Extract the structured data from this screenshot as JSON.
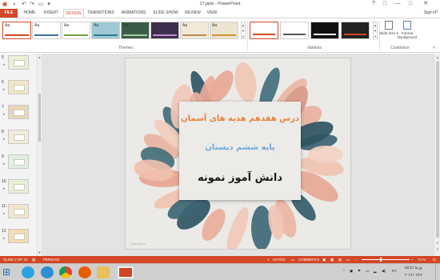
{
  "window": {
    "title": "17.pptx - PowerPoint",
    "controls": [
      "?",
      "□",
      "—",
      "□",
      "✕"
    ]
  },
  "quick_access": [
    "floppy-disk-icon",
    "undo-icon",
    "redo-icon",
    "slideshow-icon"
  ],
  "ribbon": {
    "tabs": [
      "FILE",
      "HOME",
      "INSERT",
      "DESIGN",
      "TRANSITIONS",
      "ANIMATIONS",
      "SLIDE SHOW",
      "REVIEW",
      "VIEW"
    ],
    "active_tab": "DESIGN",
    "sign_in": "Sign in",
    "themes": {
      "label": "Themes",
      "items": [
        {
          "name": "Aa",
          "bg": "#ffffff",
          "accent": "#d24726"
        },
        {
          "name": "Aa",
          "bg": "#ffffff",
          "accent": "#3a6ea5"
        },
        {
          "name": "Aa",
          "bg": "#ffffff",
          "accent": "#77a243"
        },
        {
          "name": "Aa",
          "bg": "#9fc9d4",
          "accent": "#2e7b8f"
        },
        {
          "name": "Aa",
          "bg": "#3a5c47",
          "accent": "#a7c9a0"
        },
        {
          "name": "Aa",
          "bg": "#3d2f4b",
          "accent": "#c18bd1"
        },
        {
          "name": "Aa",
          "bg": "#f2e9d8",
          "accent": "#b98a4d"
        },
        {
          "name": "Aa",
          "bg": "#ece4cf",
          "accent": "#c79b2e"
        }
      ]
    },
    "variants": {
      "label": "Variants",
      "items": [
        {
          "bg": "#ffffff",
          "accent": "#d24726"
        },
        {
          "bg": "#ffffff",
          "accent": "#555555"
        },
        {
          "bg": "#111111",
          "accent": "#ffffff"
        },
        {
          "bg": "#222222",
          "accent": "#d24726"
        }
      ]
    },
    "customize": {
      "label": "Customize",
      "slide_size": "Slide Size",
      "format_background": "Format Background"
    }
  },
  "slides_panel": [
    {
      "number": "5"
    },
    {
      "number": "6"
    },
    {
      "number": "7"
    },
    {
      "number": "8"
    },
    {
      "number": "9"
    },
    {
      "number": "10"
    },
    {
      "number": "11"
    },
    {
      "number": "12"
    }
  ],
  "slide": {
    "line1": "درس هفدهم هدیه های آسمان",
    "line2": "پایه ششم دبستان",
    "line3": "دانش آموز نمونه",
    "line1_color": "#e8823a",
    "line2_color": "#6ea8d8",
    "line3_color": "#1a1a1a",
    "watermark": "CaneVarm"
  },
  "status_bar": {
    "slide_info": "SLIDE 2 OF 21",
    "language": "PERSIAN",
    "notes": "NOTES",
    "comments": "COMMENTS",
    "zoom": "74 %"
  },
  "taskbar": {
    "apps": [
      "telegram-icon",
      "internet-explorer-icon",
      "chrome-icon",
      "firefox-icon",
      "file-explorer-icon",
      "powerpoint-icon"
    ],
    "lang": "FA",
    "time": "02:27 ق.ظ",
    "date": "۲۰۲۱/۰۱/۲۷"
  }
}
